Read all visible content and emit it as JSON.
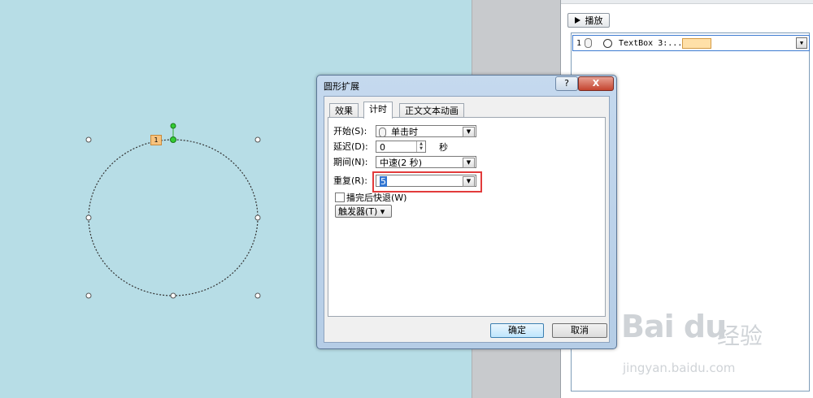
{
  "animation_pane": {
    "play_label": "播放",
    "item": {
      "number": "1",
      "label": "TextBox 3:...",
      "dropdown_symbol": "▼"
    }
  },
  "slide": {
    "shape_badge": "1"
  },
  "dialog": {
    "title": "圆形扩展",
    "help_symbol": "?",
    "close_symbol": "X",
    "tabs": [
      {
        "label": "效果"
      },
      {
        "label": "计时"
      },
      {
        "label": "正文文本动画"
      }
    ],
    "active_tab": 1,
    "fields": {
      "start": {
        "label": "开始(S):",
        "value": "单击时"
      },
      "delay": {
        "label": "延迟(D):",
        "value": "0",
        "unit": "秒"
      },
      "duration": {
        "label": "期间(N):",
        "value": "中速(2 秒)"
      },
      "repeat": {
        "label": "重复(R):",
        "value": "5"
      }
    },
    "rewind_label": "播完后快退(W)",
    "rewind_checked": false,
    "trigger_label": "触发器(T) ▾",
    "ok_label": "确定",
    "cancel_label": "取消"
  },
  "watermark": {
    "logo": "Bai du",
    "cn": "经验",
    "url": "jingyan.baidu.com"
  },
  "colors": {
    "slide_bg": "#b7dde6",
    "highlight": "#e23b3b",
    "badge": "#f7c27d"
  }
}
